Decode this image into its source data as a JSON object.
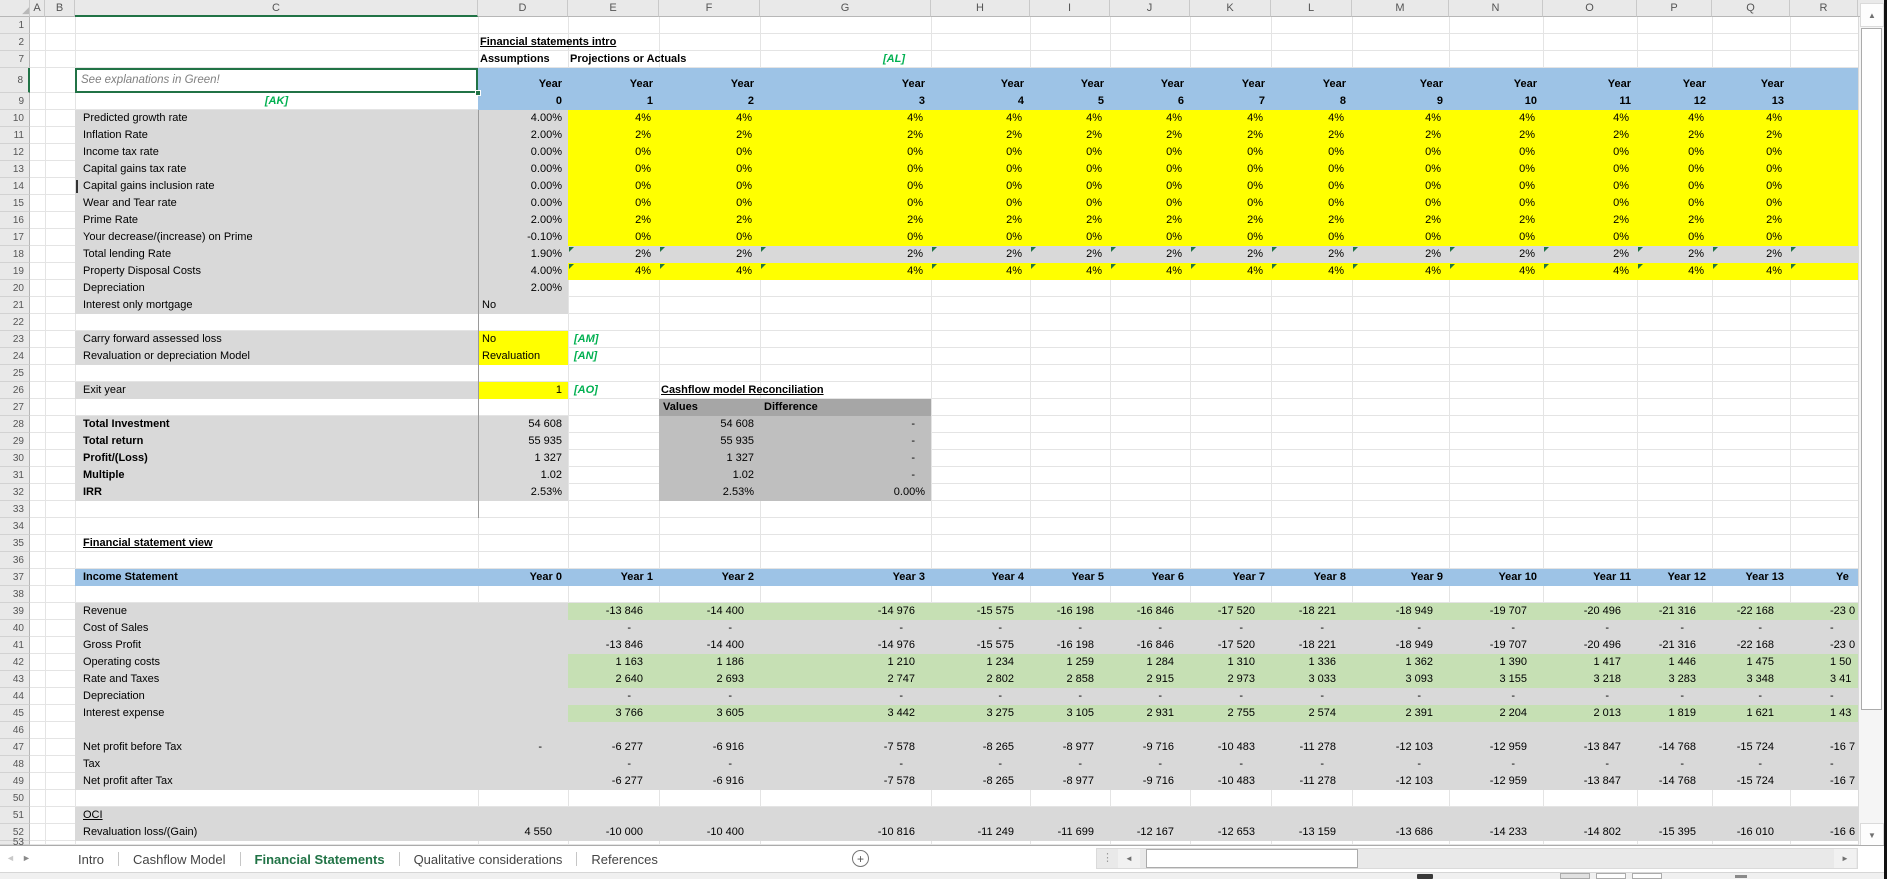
{
  "colors": {
    "accent_green": "#217346",
    "tag_green": "#00B050",
    "header_blue": "#9DC3E6",
    "input_yellow": "#FFFF00",
    "band_green": "#C6E0B4",
    "row_gray": "#D9D9D9",
    "recon_header_gray": "#A6A6A6",
    "recon_body_gray": "#BFBFBF"
  },
  "icons": {
    "select_all": "◢",
    "scroll_up": "▲",
    "scroll_down": "▼",
    "scroll_left": "◄",
    "scroll_right": "►",
    "tab_nav_left": "◄",
    "tab_nav_right": "►",
    "drag_dots": "⋮",
    "add_sheet": "+"
  },
  "grid": {
    "column_letters": [
      "A",
      "B",
      "C",
      "D",
      "E",
      "F",
      "G",
      "H",
      "I",
      "J",
      "K",
      "L",
      "M",
      "N",
      "O",
      "P",
      "Q",
      "R"
    ],
    "visible_row_numbers": [
      1,
      2,
      7,
      8,
      9,
      10,
      11,
      12,
      13,
      14,
      15,
      16,
      17,
      18,
      19,
      20,
      21,
      22,
      23,
      24,
      25,
      26,
      27,
      28,
      29,
      30,
      31,
      32,
      33,
      34,
      35,
      36,
      37,
      38,
      39,
      40,
      41,
      42,
      43,
      44,
      45,
      46,
      47,
      48,
      49,
      50,
      51,
      52,
      53
    ]
  },
  "intro": {
    "title": "Financial statements intro",
    "assumptions_label": "Assumptions",
    "projections_label": "Projections or Actuals",
    "tag_al": "[AL]",
    "note": "See explanations in Green!",
    "tag_ak": "[AK]",
    "year_word": "Year",
    "year_numbers": [
      "0",
      "1",
      "2",
      "3",
      "4",
      "5",
      "6",
      "7",
      "8",
      "9",
      "10",
      "11",
      "12",
      "13"
    ]
  },
  "assumption_rows": [
    {
      "label": "Predicted growth rate",
      "year0": "4.00%",
      "value": "4%",
      "fill": "yellow",
      "flags": false
    },
    {
      "label": "Inflation Rate",
      "year0": "2.00%",
      "value": "2%",
      "fill": "yellow",
      "flags": false
    },
    {
      "label": "Income tax rate",
      "year0": "0.00%",
      "value": "0%",
      "fill": "yellow",
      "flags": false
    },
    {
      "label": "Capital gains tax rate",
      "year0": "0.00%",
      "value": "0%",
      "fill": "yellow",
      "flags": false
    },
    {
      "label": "Capital gains inclusion rate",
      "year0": "0.00%",
      "value": "0%",
      "fill": "yellow",
      "flags": false
    },
    {
      "label": "Wear and Tear rate",
      "year0": "0.00%",
      "value": "0%",
      "fill": "yellow",
      "flags": false
    },
    {
      "label": "Prime Rate",
      "year0": "2.00%",
      "value": "2%",
      "fill": "yellow",
      "flags": false
    },
    {
      "label": "Your decrease/(increase) on Prime",
      "year0": "-0.10%",
      "value": "0%",
      "fill": "yellow",
      "flags": false
    },
    {
      "label": "Total lending Rate",
      "year0": "1.90%",
      "value": "2%",
      "fill": "gray",
      "flags": true
    },
    {
      "label": "Property Disposal Costs",
      "year0": "4.00%",
      "value": "4%",
      "fill": "yellow",
      "flags": true
    },
    {
      "label": "Depreciation",
      "year0": "2.00%",
      "value": "",
      "fill": "none",
      "flags": false
    },
    {
      "label": "Interest only mortgage",
      "year0": "No",
      "year0_align": "left",
      "value": "",
      "fill": "none",
      "flags": false
    }
  ],
  "settings_rows": [
    {
      "label": "Carry forward assessed loss",
      "value": "No",
      "tag": "[AM]"
    },
    {
      "label": "Revaluation or depreciation Model",
      "value": "Revaluation",
      "tag": "[AN]"
    }
  ],
  "exit_row": {
    "label": "Exit year",
    "value": "1",
    "tag": "[AO]"
  },
  "reconciliation": {
    "title": "Cashflow model Reconciliation",
    "col1": "Values",
    "col2": "Difference"
  },
  "summary_rows": [
    {
      "label": "Total Investment",
      "value": "54 608",
      "recon_value": "54 608",
      "recon_diff": "-"
    },
    {
      "label": "Total return",
      "value": "55 935",
      "recon_value": "55 935",
      "recon_diff": "-"
    },
    {
      "label": "Profit/(Loss)",
      "value": "1 327",
      "recon_value": "1 327",
      "recon_diff": "-"
    },
    {
      "label": "Multiple",
      "value": "1.02",
      "recon_value": "1.02",
      "recon_diff": "-"
    },
    {
      "label": "IRR",
      "value": "2.53%",
      "recon_value": "2.53%",
      "recon_diff": "0.00%"
    }
  ],
  "statement": {
    "section_title": "Financial statement view",
    "title": "Income Statement",
    "year_headers": [
      "Year 0",
      "Year 1",
      "Year 2",
      "Year 3",
      "Year 4",
      "Year 5",
      "Year 6",
      "Year 7",
      "Year 8",
      "Year 9",
      "Year 10",
      "Year 11",
      "Year 12",
      "Year 13"
    ],
    "year_header_cut": "Ye",
    "rows": [
      {
        "label": "Revenue",
        "year0": "",
        "values": [
          "-13 846",
          "-14 400",
          "-14 976",
          "-15 575",
          "-16 198",
          "-16 846",
          "-17 520",
          "-18 221",
          "-18 949",
          "-19 707",
          "-20 496",
          "-21 316",
          "-22 168"
        ],
        "cut": "-23 0",
        "band": "green"
      },
      {
        "label": "Cost of Sales",
        "year0": "",
        "values": [
          "-",
          "-",
          "-",
          "-",
          "-",
          "-",
          "-",
          "-",
          "-",
          "-",
          "-",
          "-",
          "-"
        ],
        "cut": "-",
        "band": "none"
      },
      {
        "label": "Gross Profit",
        "year0": "",
        "values": [
          "-13 846",
          "-14 400",
          "-14 976",
          "-15 575",
          "-16 198",
          "-16 846",
          "-17 520",
          "-18 221",
          "-18 949",
          "-19 707",
          "-20 496",
          "-21 316",
          "-22 168"
        ],
        "cut": "-23 0",
        "band": "none"
      },
      {
        "label": "Operating costs",
        "year0": "",
        "values": [
          "1 163",
          "1 186",
          "1 210",
          "1 234",
          "1 259",
          "1 284",
          "1 310",
          "1 336",
          "1 362",
          "1 390",
          "1 417",
          "1 446",
          "1 475"
        ],
        "cut": "1 50",
        "band": "green"
      },
      {
        "label": "Rate and Taxes",
        "year0": "",
        "values": [
          "2 640",
          "2 693",
          "2 747",
          "2 802",
          "2 858",
          "2 915",
          "2 973",
          "3 033",
          "3 093",
          "3 155",
          "3 218",
          "3 283",
          "3 348"
        ],
        "cut": "3 41",
        "band": "green"
      },
      {
        "label": "Depreciation",
        "year0": "",
        "values": [
          "-",
          "-",
          "-",
          "-",
          "-",
          "-",
          "-",
          "-",
          "-",
          "-",
          "-",
          "-",
          "-"
        ],
        "cut": "-",
        "band": "none"
      },
      {
        "label": "Interest expense",
        "year0": "",
        "values": [
          "3 766",
          "3 605",
          "3 442",
          "3 275",
          "3 105",
          "2 931",
          "2 755",
          "2 574",
          "2 391",
          "2 204",
          "2 013",
          "1 819",
          "1 621"
        ],
        "cut": "1 43",
        "band": "green"
      }
    ],
    "rows2": [
      {
        "label": "Net profit before Tax",
        "year0": "-",
        "values": [
          "-6 277",
          "-6 916",
          "-7 578",
          "-8 265",
          "-8 977",
          "-9 716",
          "-10 483",
          "-11 278",
          "-12 103",
          "-12 959",
          "-13 847",
          "-14 768",
          "-15 724"
        ],
        "cut": "-16 7",
        "band": "none"
      },
      {
        "label": "Tax",
        "year0": "",
        "values": [
          "-",
          "-",
          "-",
          "-",
          "-",
          "-",
          "-",
          "-",
          "-",
          "-",
          "-",
          "-",
          "-"
        ],
        "cut": "-",
        "band": "none"
      },
      {
        "label": "Net profit after Tax",
        "year0": "",
        "values": [
          "-6 277",
          "-6 916",
          "-7 578",
          "-8 265",
          "-8 977",
          "-9 716",
          "-10 483",
          "-11 278",
          "-12 103",
          "-12 959",
          "-13 847",
          "-14 768",
          "-15 724"
        ],
        "cut": "-16 7",
        "band": "none"
      }
    ],
    "oci_title": "OCI",
    "oci_row": {
      "label": "Revaluation loss/(Gain)",
      "year0": "4 550",
      "values": [
        "-10 000",
        "-10 400",
        "-10 816",
        "-11 249",
        "-11 699",
        "-12 167",
        "-12 653",
        "-13 159",
        "-13 686",
        "-14 233",
        "-14 802",
        "-15 395",
        "-16 010"
      ],
      "cut": "-16 6",
      "band": "none"
    }
  },
  "tabs": {
    "items": [
      {
        "label": "Intro",
        "active": false
      },
      {
        "label": "Cashflow Model",
        "active": false
      },
      {
        "label": "Financial Statements",
        "active": true
      },
      {
        "label": "Qualitative considerations",
        "active": false
      },
      {
        "label": "References",
        "active": false
      }
    ]
  }
}
